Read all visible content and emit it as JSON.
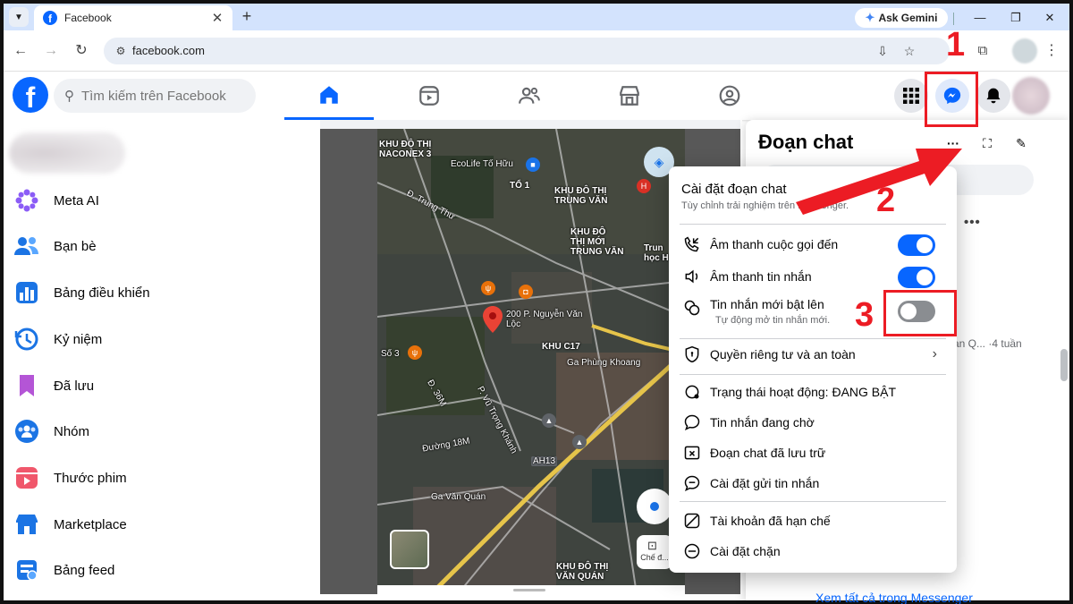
{
  "browser": {
    "tab_title": "Facebook",
    "new_tab": "+",
    "close_tab": "✕",
    "gemini_label": "Ask Gemini",
    "url": "facebook.com",
    "window_controls": {
      "minimize": "—",
      "restore": "❐",
      "close": "✕"
    }
  },
  "facebook": {
    "logo_letter": "f",
    "search_placeholder": "Tìm kiếm trên Facebook",
    "brand_color": "#0866ff",
    "nav_tabs": [
      "home-icon",
      "reels-icon",
      "friends-icon",
      "marketplace-icon",
      "gaming-icon"
    ],
    "active_tab": "home-icon",
    "right_buttons": [
      "menu-grid-icon",
      "messenger-icon",
      "bell-icon"
    ]
  },
  "sidebar": {
    "items": [
      {
        "label": "Meta AI",
        "icon": "meta-ai-icon"
      },
      {
        "label": "Bạn bè",
        "icon": "friends-icon"
      },
      {
        "label": "Bảng điều khiển",
        "icon": "dashboard-icon"
      },
      {
        "label": "Kỷ niệm",
        "icon": "memories-icon"
      },
      {
        "label": "Đã lưu",
        "icon": "saved-icon"
      },
      {
        "label": "Nhóm",
        "icon": "groups-icon"
      },
      {
        "label": "Thước phim",
        "icon": "reels-icon"
      },
      {
        "label": "Marketplace",
        "icon": "marketplace-icon"
      },
      {
        "label": "Bảng feed",
        "icon": "feed-icon"
      }
    ]
  },
  "map": {
    "labels": {
      "l1": "KHU ĐÔ THỊ\nNACONEX 3",
      "l2": "EcoLife Tố Hữu",
      "l3": "TỔ 1",
      "l4": "KHU ĐÔ THỊ\nTRUNG VĂN",
      "l5": "KHU ĐÔ\nTHỊ MỚI\nTRUNG VĂN",
      "l6": "Trun\nhọc H",
      "l7": "Đ. Trung Thư",
      "l8": "200 P. Nguyễn Văn\nLộc",
      "l9": "KHU C17",
      "l10": "Ga Phùng Khoang",
      "l11": "Số 3",
      "l12": "Đường 18M",
      "l13": "P. Vũ Trọng Khánh",
      "l14": "AH13",
      "l15": "Ga Văn Quán",
      "l16": "KHU ĐÔ THỊ\nVĂN QUÁN",
      "l17": "Đ. 36M"
    },
    "mode_label": "Chế đ..."
  },
  "chat": {
    "title": "Đoạn chat",
    "more": "•••",
    "preview": "an Q... ·4 tuần",
    "footer_link": "Xem tất cả trong Messenger"
  },
  "dropdown": {
    "title": "Cài đặt đoạn chat",
    "subtitle": "Tùy chỉnh trải nghiệm trên Messenger.",
    "toggles": [
      {
        "label": "Âm thanh cuộc gọi đến",
        "icon": "incoming-call-icon",
        "on": true
      },
      {
        "label": "Âm thanh tin nhắn",
        "icon": "speaker-icon",
        "on": true
      },
      {
        "label": "Tin nhắn mới bật lên",
        "desc": "Tự động mở tin nhắn mới.",
        "icon": "popup-chat-icon",
        "on": false
      }
    ],
    "privacy": "Quyền riêng tư và an toàn",
    "items": [
      {
        "label": "Trạng thái hoạt động: ĐANG BẬT",
        "icon": "active-status-icon"
      },
      {
        "label": "Tin nhắn đang chờ",
        "icon": "pending-messages-icon"
      },
      {
        "label": "Đoạn chat đã lưu trữ",
        "icon": "archive-icon"
      },
      {
        "label": "Cài đặt gửi tin nhắn",
        "icon": "message-delivery-icon"
      },
      {
        "label": "Tài khoản đã hạn chế",
        "icon": "restricted-icon"
      },
      {
        "label": "Cài đặt chặn",
        "icon": "block-icon"
      }
    ]
  },
  "annotations": {
    "n1": "1",
    "n2": "2",
    "n3": "3",
    "color": "#ec1c24"
  }
}
